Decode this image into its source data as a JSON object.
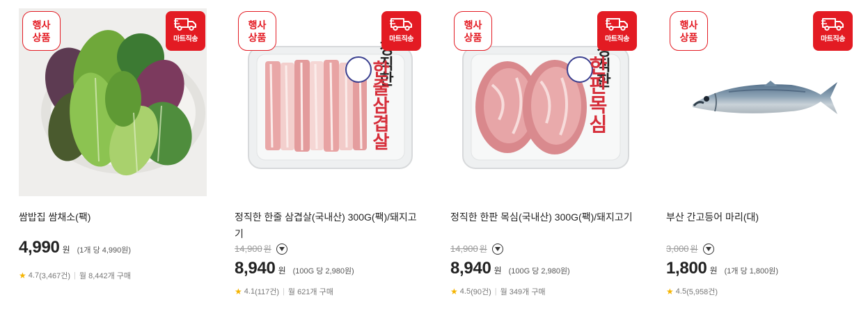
{
  "badges": {
    "event_line1": "행사",
    "event_line2": "상품",
    "mart": "마트직송"
  },
  "products": [
    {
      "name": "쌈밥집 쌈채소(팩)",
      "original_price": "",
      "price": "4,990",
      "currency": "원",
      "unit_price": "(1개 당 4,990원)",
      "rating": "4.7",
      "review_count": "(3,467건)",
      "monthly_sales": "월 8,442개 구매",
      "image_icon": "vegetables-image"
    },
    {
      "name": "정직한 한줄 삼겹살(국내산) 300G(팩)/돼지고기",
      "original_price": "14,900",
      "price": "8,940",
      "currency": "원",
      "unit_price": "(100G 당 2,980원)",
      "rating": "4.1",
      "review_count": "(117건)",
      "monthly_sales": "월 621개 구매",
      "image_icon": "pork-belly-image",
      "pack_label": "한줄삼겹살",
      "pack_brand": "정직한"
    },
    {
      "name": "정직한 한판 목심(국내산) 300G(팩)/돼지고기",
      "original_price": "14,900",
      "price": "8,940",
      "currency": "원",
      "unit_price": "(100G 당 2,980원)",
      "rating": "4.5",
      "review_count": "(90건)",
      "monthly_sales": "월 349개 구매",
      "image_icon": "pork-neck-image",
      "pack_label": "한판목심",
      "pack_brand": "정직한"
    },
    {
      "name": "부산 간고등어 마리(대)",
      "original_price": "3,000",
      "price": "1,800",
      "currency": "원",
      "unit_price": "(1개 당 1,800원)",
      "rating": "4.5",
      "review_count": "(5,958건)",
      "monthly_sales": "",
      "image_icon": "mackerel-image"
    }
  ],
  "colors": {
    "accent_red": "#e31b23",
    "star": "#f5b400",
    "strike_gray": "#999999"
  }
}
